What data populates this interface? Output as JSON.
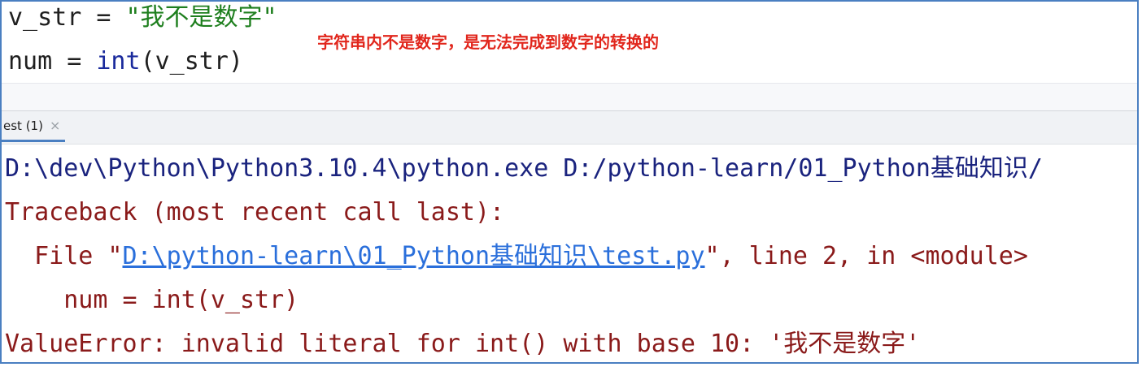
{
  "editor": {
    "line1_var": "v_str = ",
    "line1_str": "\"我不是数字\"",
    "line2_prefix": "num = ",
    "line2_builtin": "int",
    "line2_suffix": "(v_str)"
  },
  "annotation": "字符串内不是数字，是无法完成到数字的转换的",
  "run_tab": {
    "label": "est (1)",
    "close_glyph": "×"
  },
  "console": {
    "command": "D:\\dev\\Python\\Python3.10.4\\python.exe D:/python-learn/01_Python基础知识/",
    "traceback": "Traceback (most recent call last):",
    "file_prefix": "  File \"",
    "file_link": "D:\\python-learn\\01_Python基础知识\\test.py",
    "file_suffix": "\", line 2, in <module>",
    "code_line": "    num = int(v_str)",
    "error": "ValueError: invalid literal for int() with base 10: '我不是数字'"
  },
  "colors": {
    "annotation": "#e1261c",
    "string": "#1e7f1e",
    "builtin": "#1a2a9c",
    "command": "#1a237e",
    "error": "#8a1a1a",
    "link": "#2a6fdb",
    "frame_border": "#4a7fc1"
  }
}
